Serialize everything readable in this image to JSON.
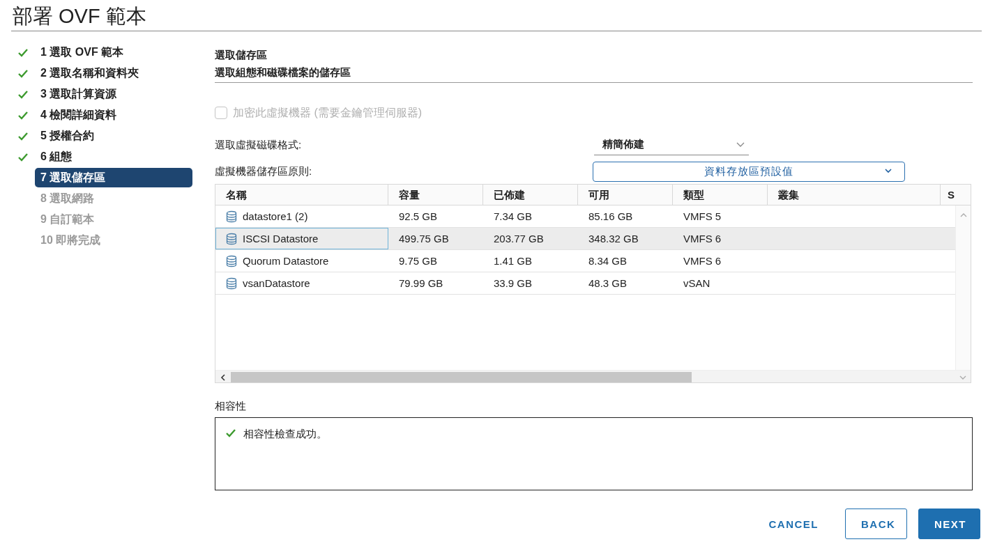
{
  "window": {
    "title": "部署 OVF 範本"
  },
  "steps": [
    {
      "label": "1 選取 OVF 範本",
      "completed": true,
      "selected": false,
      "disabled": false
    },
    {
      "label": "2 選取名稱和資料夾",
      "completed": true,
      "selected": false,
      "disabled": false
    },
    {
      "label": "3 選取計算資源",
      "completed": true,
      "selected": false,
      "disabled": false
    },
    {
      "label": "4 檢閱詳細資料",
      "completed": true,
      "selected": false,
      "disabled": false
    },
    {
      "label": "5 授權合約",
      "completed": true,
      "selected": false,
      "disabled": false
    },
    {
      "label": "6 組態",
      "completed": true,
      "selected": false,
      "disabled": false
    },
    {
      "label": "7 選取儲存區",
      "completed": false,
      "selected": true,
      "disabled": false
    },
    {
      "label": "8 選取網路",
      "completed": false,
      "selected": false,
      "disabled": true
    },
    {
      "label": "9 自訂範本",
      "completed": false,
      "selected": false,
      "disabled": true
    },
    {
      "label": "10 即將完成",
      "completed": false,
      "selected": false,
      "disabled": true
    }
  ],
  "page": {
    "title": "選取儲存區",
    "subtitle": "選取組態和磁碟檔案的儲存區"
  },
  "encrypt_checkbox": {
    "label": "加密此虛擬機器 (需要金鑰管理伺服器)",
    "checked": false,
    "disabled": true
  },
  "disk_format": {
    "label": "選取虛擬磁碟格式:",
    "value": "精簡佈建"
  },
  "storage_policy": {
    "label": "虛擬機器儲存區原則:",
    "value": "資料存放區預設值"
  },
  "table": {
    "columns": [
      "名稱",
      "容量",
      "已佈建",
      "可用",
      "類型",
      "叢集",
      "S"
    ],
    "rows": [
      {
        "cells": [
          "datastore1 (2)",
          "92.5 GB",
          "7.34 GB",
          "85.16 GB",
          "VMFS 5",
          ""
        ],
        "selected": false
      },
      {
        "cells": [
          "ISCSI Datastore",
          "499.75 GB",
          "203.77 GB",
          "348.32 GB",
          "VMFS 6",
          ""
        ],
        "selected": true
      },
      {
        "cells": [
          "Quorum Datastore",
          "9.75 GB",
          "1.41 GB",
          "8.34 GB",
          "VMFS 6",
          ""
        ],
        "selected": false
      },
      {
        "cells": [
          "vsanDatastore",
          "79.99 GB",
          "33.9 GB",
          "48.3 GB",
          "vSAN",
          ""
        ],
        "selected": false
      }
    ]
  },
  "compatibility": {
    "label": "相容性",
    "message": "相容性檢查成功。"
  },
  "buttons": [
    {
      "label": "CANCEL",
      "kind": "flat"
    },
    {
      "label": "BACK",
      "kind": "outline"
    },
    {
      "label": "NEXT",
      "kind": "primary"
    }
  ]
}
